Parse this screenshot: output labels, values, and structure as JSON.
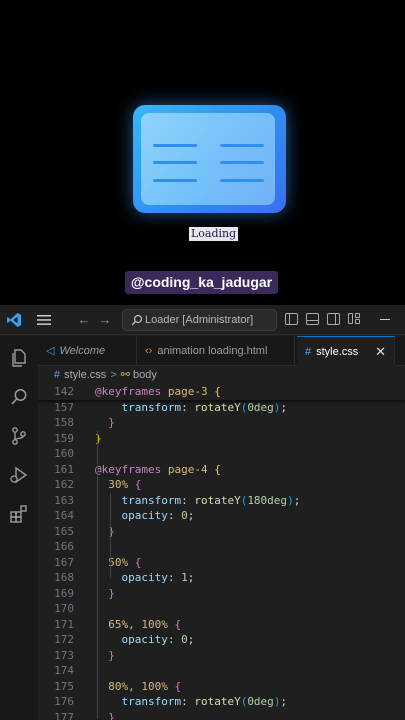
{
  "preview": {
    "loading_text": "Loading",
    "handle": "@coding_ka_jadugar"
  },
  "titlebar": {
    "search": "Loader [Administrator]"
  },
  "tabs": [
    {
      "label": "Welcome",
      "icon": "vscode-icon"
    },
    {
      "label": "animation loading.html",
      "icon": "html-icon"
    },
    {
      "label": "style.css",
      "icon": "css-icon",
      "active": true
    }
  ],
  "breadcrumb": {
    "file": "style.css",
    "symbol": "body"
  },
  "code": [
    {
      "ln": "142",
      "tokens": [
        {
          "t": "@keyframes",
          "c": "kw"
        },
        {
          "t": " page-3 ",
          "c": "sel"
        },
        {
          "t": "{",
          "c": "b1"
        }
      ],
      "sticky": true,
      "indent": 4
    },
    {
      "ln": "157",
      "tokens": [
        {
          "t": "transform",
          "c": "prop"
        },
        {
          "t": ": ",
          "c": "pun"
        },
        {
          "t": "rotateY",
          "c": "fn"
        },
        {
          "t": "(",
          "c": "b3"
        },
        {
          "t": "0deg",
          "c": "num"
        },
        {
          "t": ")",
          "c": "b3"
        },
        {
          "t": ";",
          "c": "pun"
        }
      ],
      "indent": 8
    },
    {
      "ln": "158",
      "tokens": [
        {
          "t": "}",
          "c": "b2"
        }
      ],
      "indent": 6
    },
    {
      "ln": "159",
      "tokens": [
        {
          "t": "}",
          "c": "b1"
        }
      ],
      "indent": 4
    },
    {
      "ln": "160",
      "tokens": [],
      "indent": 0
    },
    {
      "ln": "161",
      "tokens": [
        {
          "t": "@keyframes",
          "c": "kw"
        },
        {
          "t": " page-4 ",
          "c": "sel"
        },
        {
          "t": "{",
          "c": "b1"
        }
      ],
      "indent": 4
    },
    {
      "ln": "162",
      "tokens": [
        {
          "t": "30% ",
          "c": "sel"
        },
        {
          "t": "{",
          "c": "b2"
        }
      ],
      "indent": 6
    },
    {
      "ln": "163",
      "tokens": [
        {
          "t": "transform",
          "c": "prop"
        },
        {
          "t": ": ",
          "c": "pun"
        },
        {
          "t": "rotateY",
          "c": "fn"
        },
        {
          "t": "(",
          "c": "b3"
        },
        {
          "t": "180deg",
          "c": "num"
        },
        {
          "t": ")",
          "c": "b3"
        },
        {
          "t": ";",
          "c": "pun"
        }
      ],
      "indent": 8
    },
    {
      "ln": "164",
      "tokens": [
        {
          "t": "opacity",
          "c": "prop"
        },
        {
          "t": ": ",
          "c": "pun"
        },
        {
          "t": "0",
          "c": "num"
        },
        {
          "t": ";",
          "c": "pun"
        }
      ],
      "indent": 8
    },
    {
      "ln": "165",
      "tokens": [
        {
          "t": "}",
          "c": "b2"
        }
      ],
      "indent": 6
    },
    {
      "ln": "166",
      "tokens": [],
      "indent": 0
    },
    {
      "ln": "167",
      "tokens": [
        {
          "t": "50% ",
          "c": "sel"
        },
        {
          "t": "{",
          "c": "b2"
        }
      ],
      "indent": 6
    },
    {
      "ln": "168",
      "tokens": [
        {
          "t": "opacity",
          "c": "prop"
        },
        {
          "t": ": ",
          "c": "pun"
        },
        {
          "t": "1",
          "c": "num"
        },
        {
          "t": ";",
          "c": "pun"
        }
      ],
      "indent": 8
    },
    {
      "ln": "169",
      "tokens": [
        {
          "t": "}",
          "c": "b2"
        }
      ],
      "indent": 6
    },
    {
      "ln": "170",
      "tokens": [],
      "indent": 0
    },
    {
      "ln": "171",
      "tokens": [
        {
          "t": "65%, 100% ",
          "c": "sel"
        },
        {
          "t": "{",
          "c": "b2"
        }
      ],
      "indent": 6
    },
    {
      "ln": "172",
      "tokens": [
        {
          "t": "opacity",
          "c": "prop"
        },
        {
          "t": ": ",
          "c": "pun"
        },
        {
          "t": "0",
          "c": "num"
        },
        {
          "t": ";",
          "c": "pun"
        }
      ],
      "indent": 8
    },
    {
      "ln": "173",
      "tokens": [
        {
          "t": "}",
          "c": "b2"
        }
      ],
      "indent": 6
    },
    {
      "ln": "174",
      "tokens": [],
      "indent": 0
    },
    {
      "ln": "175",
      "tokens": [
        {
          "t": "80%, 100% ",
          "c": "sel"
        },
        {
          "t": "{",
          "c": "b2"
        }
      ],
      "indent": 6
    },
    {
      "ln": "176",
      "tokens": [
        {
          "t": "transform",
          "c": "prop"
        },
        {
          "t": ": ",
          "c": "pun"
        },
        {
          "t": "rotateY",
          "c": "fn"
        },
        {
          "t": "(",
          "c": "b3"
        },
        {
          "t": "0deg",
          "c": "num"
        },
        {
          "t": ")",
          "c": "b3"
        },
        {
          "t": ";",
          "c": "pun"
        }
      ],
      "indent": 8
    },
    {
      "ln": "177",
      "tokens": [
        {
          "t": "}",
          "c": "b2"
        }
      ],
      "indent": 6
    }
  ],
  "colors": {
    "accent": "#0078d4",
    "book": "#2f8ef0"
  }
}
